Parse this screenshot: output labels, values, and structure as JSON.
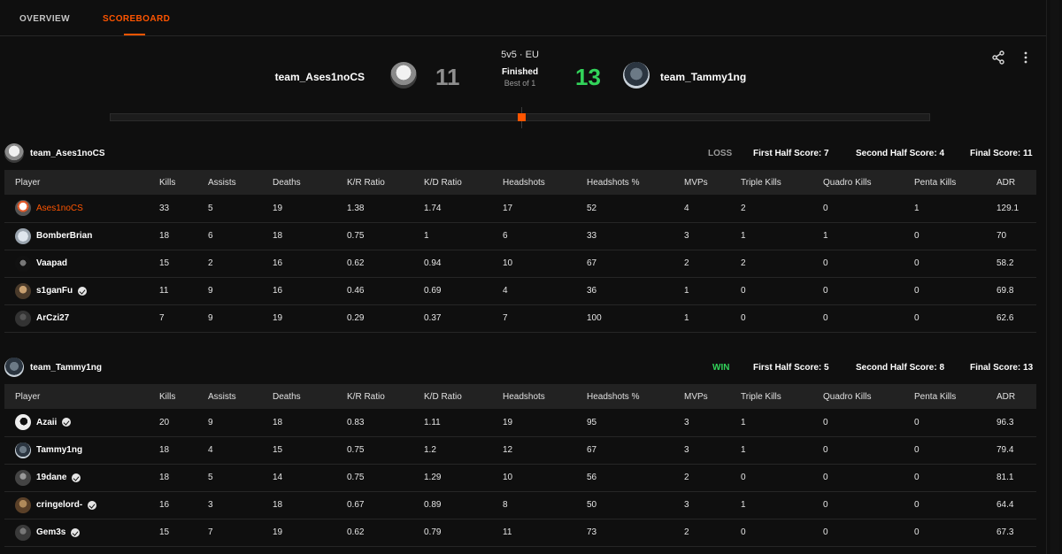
{
  "tabs": [
    {
      "label": "OVERVIEW",
      "active": false
    },
    {
      "label": "SCOREBOARD",
      "active": true
    }
  ],
  "accent_color": "#ff5500",
  "win_color": "#32d35a",
  "match": {
    "team_left": {
      "name": "team_Ases1noCS",
      "score": "11"
    },
    "team_right": {
      "name": "team_Tammy1ng",
      "score": "13"
    },
    "mode": "5v5 · EU",
    "status": "Finished",
    "best_of": "Best of 1",
    "icons": [
      "share-icon",
      "more-vertical-icon"
    ]
  },
  "columns": [
    "Player",
    "Kills",
    "Assists",
    "Deaths",
    "K/R Ratio",
    "K/D Ratio",
    "Headshots",
    "Headshots %",
    "MVPs",
    "Triple Kills",
    "Quadro Kills",
    "Penta Kills",
    "ADR"
  ],
  "teams": [
    {
      "name": "team_Ases1noCS",
      "result": "LOSS",
      "first_half": "First Half Score: 7",
      "second_half": "Second Half Score: 4",
      "final": "Final Score: 11",
      "players": [
        {
          "name": "Ases1noCS",
          "verified": false,
          "highlight": true,
          "stats": [
            "33",
            "5",
            "19",
            "1.38",
            "1.74",
            "17",
            "52",
            "4",
            "2",
            "0",
            "1",
            "129.1"
          ]
        },
        {
          "name": "BomberBrian",
          "verified": false,
          "highlight": false,
          "stats": [
            "18",
            "6",
            "18",
            "0.75",
            "1",
            "6",
            "33",
            "3",
            "1",
            "1",
            "0",
            "70"
          ]
        },
        {
          "name": "Vaapad",
          "verified": false,
          "highlight": false,
          "stats": [
            "15",
            "2",
            "16",
            "0.62",
            "0.94",
            "10",
            "67",
            "2",
            "2",
            "0",
            "0",
            "58.2"
          ]
        },
        {
          "name": "s1ganFu",
          "verified": true,
          "highlight": false,
          "stats": [
            "11",
            "9",
            "16",
            "0.46",
            "0.69",
            "4",
            "36",
            "1",
            "0",
            "0",
            "0",
            "69.8"
          ]
        },
        {
          "name": "ArCzi27",
          "verified": false,
          "highlight": false,
          "stats": [
            "7",
            "9",
            "19",
            "0.29",
            "0.37",
            "7",
            "100",
            "1",
            "0",
            "0",
            "0",
            "62.6"
          ]
        }
      ]
    },
    {
      "name": "team_Tammy1ng",
      "result": "WIN",
      "first_half": "First Half Score: 5",
      "second_half": "Second Half Score: 8",
      "final": "Final Score: 13",
      "players": [
        {
          "name": "Azaii",
          "verified": true,
          "highlight": false,
          "stats": [
            "20",
            "9",
            "18",
            "0.83",
            "1.11",
            "19",
            "95",
            "3",
            "1",
            "0",
            "0",
            "96.3"
          ]
        },
        {
          "name": "Tammy1ng",
          "verified": false,
          "highlight": false,
          "stats": [
            "18",
            "4",
            "15",
            "0.75",
            "1.2",
            "12",
            "67",
            "3",
            "1",
            "0",
            "0",
            "79.4"
          ]
        },
        {
          "name": "19dane",
          "verified": true,
          "highlight": false,
          "stats": [
            "18",
            "5",
            "14",
            "0.75",
            "1.29",
            "10",
            "56",
            "2",
            "0",
            "0",
            "0",
            "81.1"
          ]
        },
        {
          "name": "cringelord-",
          "verified": true,
          "highlight": false,
          "stats": [
            "16",
            "3",
            "18",
            "0.67",
            "0.89",
            "8",
            "50",
            "3",
            "1",
            "0",
            "0",
            "64.4"
          ]
        },
        {
          "name": "Gem3s",
          "verified": true,
          "highlight": false,
          "stats": [
            "15",
            "7",
            "19",
            "0.62",
            "0.79",
            "11",
            "73",
            "2",
            "0",
            "0",
            "0",
            "67.3"
          ]
        }
      ]
    }
  ]
}
